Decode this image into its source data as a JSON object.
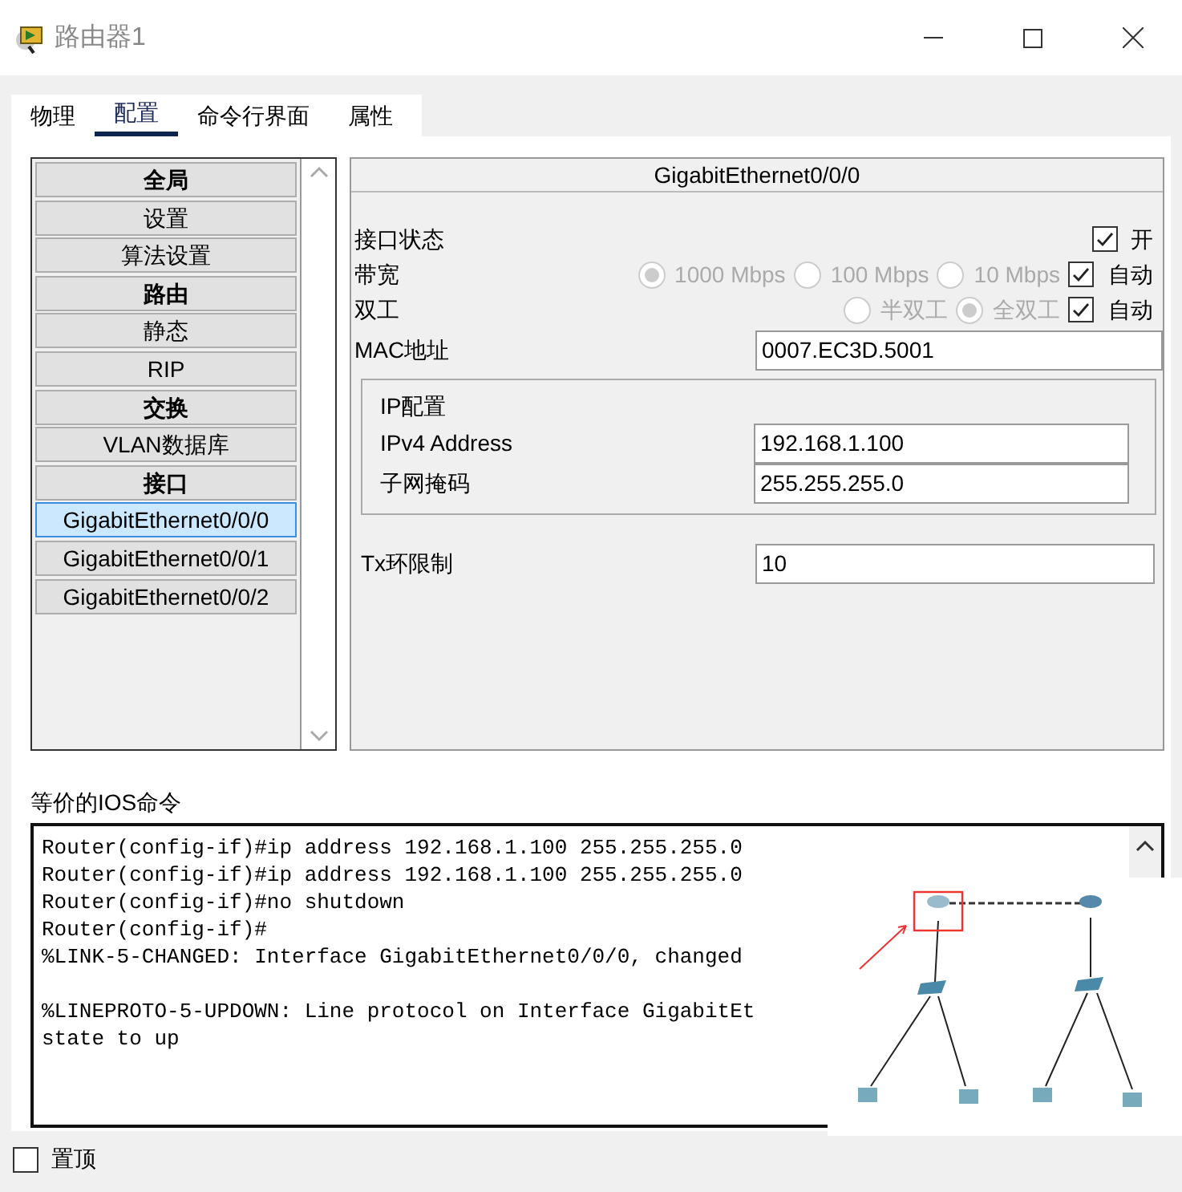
{
  "window": {
    "title": "路由器1"
  },
  "tabs": [
    {
      "label": "物理",
      "selected": false
    },
    {
      "label": "配置",
      "selected": true
    },
    {
      "label": "命令行界面",
      "selected": false
    },
    {
      "label": "属性",
      "selected": false
    }
  ],
  "sidebar": {
    "items": [
      {
        "label": "全局",
        "kind": "header",
        "selected": false
      },
      {
        "label": "设置",
        "kind": "item",
        "selected": false
      },
      {
        "label": "算法设置",
        "kind": "item",
        "selected": false
      },
      {
        "label": "路由",
        "kind": "header",
        "selected": false
      },
      {
        "label": "静态",
        "kind": "item",
        "selected": false
      },
      {
        "label": "RIP",
        "kind": "item",
        "selected": false
      },
      {
        "label": "交换",
        "kind": "header",
        "selected": false
      },
      {
        "label": "VLAN数据库",
        "kind": "item",
        "selected": false
      },
      {
        "label": "接口",
        "kind": "header",
        "selected": false
      },
      {
        "label": "GigabitEthernet0/0/0",
        "kind": "item",
        "selected": true
      },
      {
        "label": "GigabitEthernet0/0/1",
        "kind": "item",
        "selected": false
      },
      {
        "label": "GigabitEthernet0/0/2",
        "kind": "item",
        "selected": false
      }
    ]
  },
  "interface": {
    "title": "GigabitEthernet0/0/0",
    "status": {
      "label": "接口状态",
      "on_label": "开",
      "checked": true
    },
    "bandwidth": {
      "label": "带宽",
      "options": [
        {
          "label": "1000 Mbps",
          "selected": true
        },
        {
          "label": "100 Mbps",
          "selected": false
        },
        {
          "label": "10 Mbps",
          "selected": false
        }
      ],
      "auto_label": "自动",
      "auto_checked": true
    },
    "duplex": {
      "label": "双工",
      "options": [
        {
          "label": "半双工",
          "selected": false
        },
        {
          "label": "全双工",
          "selected": true
        }
      ],
      "auto_label": "自动",
      "auto_checked": true
    },
    "mac": {
      "label": "MAC地址",
      "value": "0007.EC3D.5001"
    },
    "ip_config": {
      "title": "IP配置",
      "fields": [
        {
          "label": "IPv4 Address",
          "value": "192.168.1.100"
        },
        {
          "label": "子网掩码",
          "value": "255.255.255.0"
        }
      ]
    },
    "tx_ring": {
      "label": "Tx环限制",
      "value": "10"
    }
  },
  "console": {
    "label": "等价的IOS命令",
    "lines": [
      "Router(config-if)#ip address 192.168.1.100 255.255.255.0",
      "Router(config-if)#ip address 192.168.1.100 255.255.255.0",
      "Router(config-if)#no shutdown",
      "Router(config-if)#",
      "%LINK-5-CHANGED: Interface GigabitEthernet0/0/0, changed"
    ],
    "lines_after_blank": [
      "%LINEPROTO-5-UPDOWN: Line protocol on Interface GigabitEt",
      "state to up"
    ]
  },
  "stay_on_top": {
    "label": "置顶",
    "checked": false
  }
}
